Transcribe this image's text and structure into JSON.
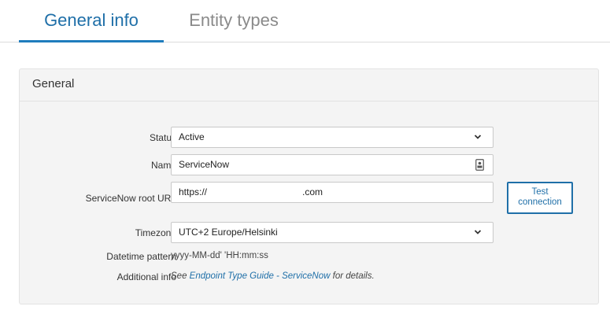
{
  "tabs": [
    {
      "label": "General info",
      "active": true
    },
    {
      "label": "Entity types",
      "active": false
    }
  ],
  "section": {
    "title": "General"
  },
  "form": {
    "status": {
      "label": "Status",
      "value": "Active"
    },
    "name": {
      "label": "Name",
      "value": "ServiceNow"
    },
    "url": {
      "label": "ServiceNow root URL",
      "value_prefix": "https://",
      "value_suffix": ".com"
    },
    "test_button": {
      "line1": "Test",
      "line2": "connection"
    },
    "timezone": {
      "label": "Timezone",
      "value": "UTC+2 Europe/Helsinki"
    },
    "datetime": {
      "label": "Datetime pattern",
      "value": "yyyy-MM-dd' 'HH:mm:ss"
    },
    "additional": {
      "label": "Additional info",
      "prefix": "See ",
      "link_text": "Endpoint Type Guide - ServiceNow",
      "suffix": " for details."
    }
  },
  "colors": {
    "accent": "#1f6fa8",
    "inactive_tab": "#8a8a8a",
    "panel_bg": "#f4f4f4"
  },
  "icons": {
    "select": "chevron-down-icon",
    "name_field": "contact-card-icon"
  }
}
